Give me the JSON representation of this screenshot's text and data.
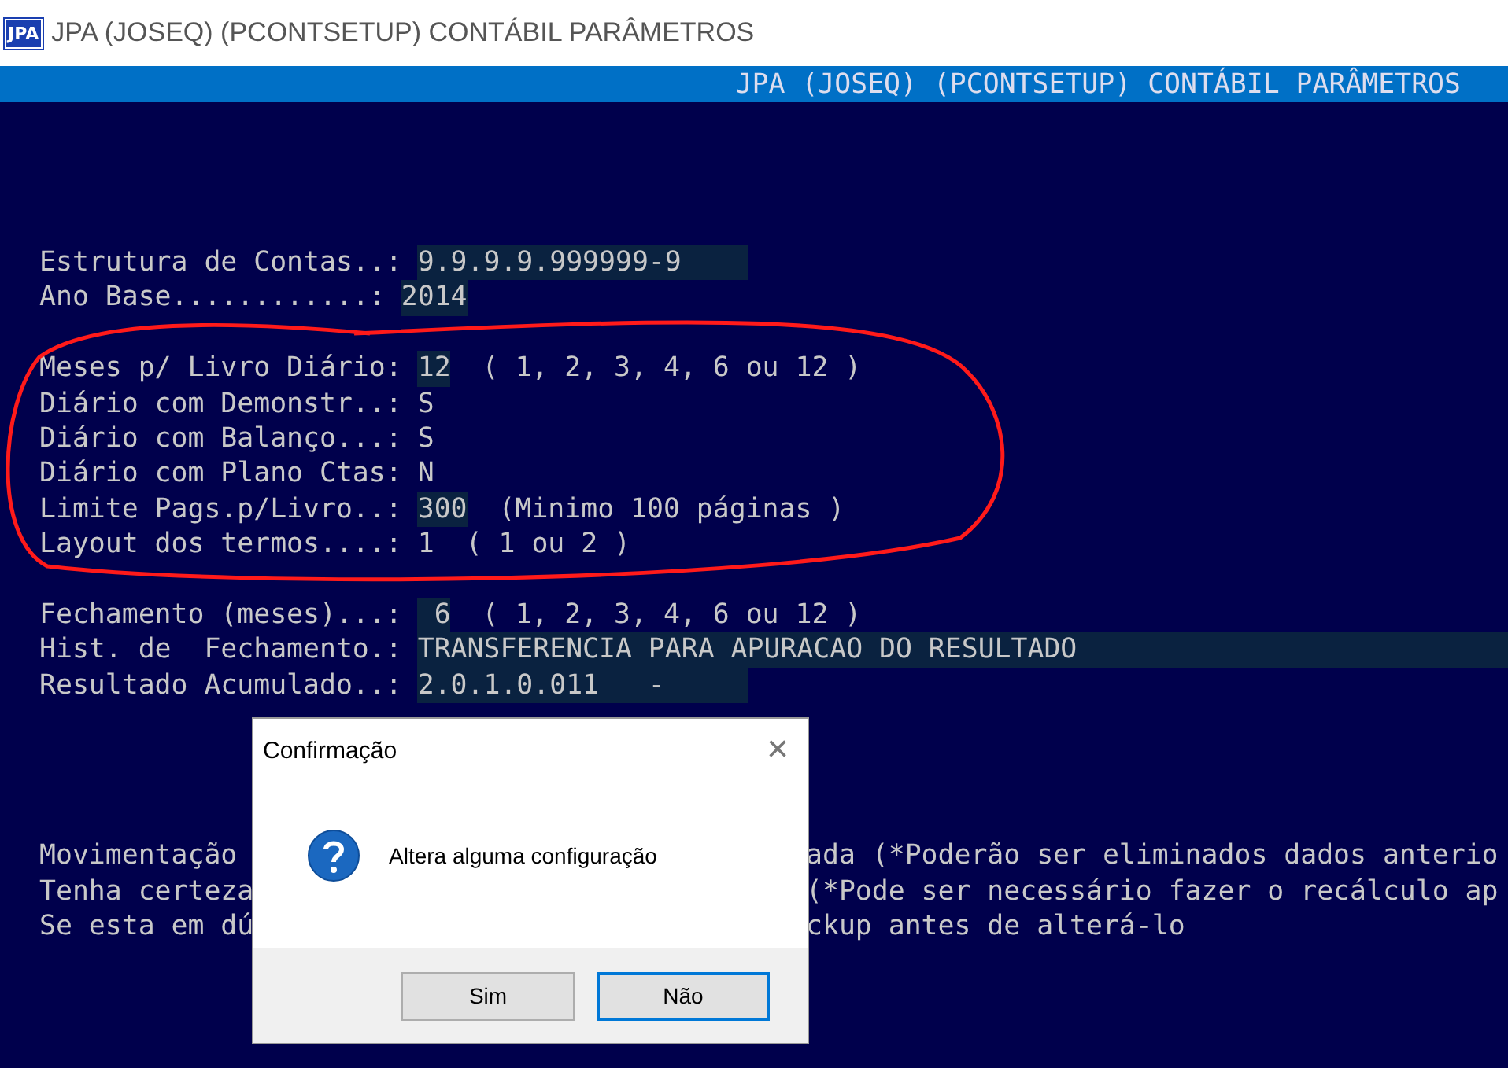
{
  "window": {
    "icon_text": "JPA",
    "title": "JPA (JOSEQ) (PCONTSETUP) CONTÁBIL PARÂMETROS"
  },
  "console": {
    "header": "JPA (JOSEQ) (PCONTSETUP) CONTÁBIL PARÂMETROS",
    "groups": [
      [
        {
          "label": "Estrutura de Contas..:",
          "value": "9.9.9.9.999999-9",
          "kind": "wide"
        },
        {
          "label": "Ano Base............:",
          "value": "2014",
          "kind": "short"
        }
      ],
      [
        {
          "label": "Meses p/ Livro Diário:",
          "value": "12",
          "note": "( 1, 2, 3, 4, 6 ou 12 )",
          "kind": "short"
        },
        {
          "label": "Diário com Demonstr..:",
          "value": "S",
          "kind": "plain"
        },
        {
          "label": "Diário com Balanço...:",
          "value": "S",
          "kind": "plain"
        },
        {
          "label": "Diário com Plano Ctas:",
          "value": "N",
          "kind": "plain"
        },
        {
          "label": "Limite Pags.p/Livro..:",
          "value": "300",
          "note": "(Minimo 100 páginas )",
          "kind": "short"
        },
        {
          "label": "Layout dos termos....:",
          "value": "1",
          "note": "( 1 ou 2 )",
          "kind": "plain"
        }
      ],
      [
        {
          "label": "Fechamento (meses)...:",
          "value": " 6",
          "note": "( 1, 2, 3, 4, 6 ou 12 )",
          "kind": "short"
        },
        {
          "label": "Hist. de  Fechamento.:",
          "value": "TRANSFERENCIA PARA APURACAO DO RESULTADO",
          "kind": "full"
        },
        {
          "label": "Resultado Acumulado..:",
          "value": "2.0.1.0.011   -",
          "kind": "wide"
        }
      ]
    ],
    "notes": [
      {
        "left": "Movimentação",
        "right": "ada (*Poderão ser eliminados dados anterio"
      },
      {
        "left": "Tenha certeza",
        "right": "(*Pode ser necessário fazer o recálculo ap"
      },
      {
        "left": "Se esta em dú",
        "right": "ckup antes de alterá-lo"
      }
    ]
  },
  "dialog": {
    "title": "Confirmação",
    "close": "×",
    "message": "Altera alguma configuração",
    "buttons": [
      {
        "label": "Sim",
        "selected": false
      },
      {
        "label": "Não",
        "selected": true
      }
    ]
  }
}
